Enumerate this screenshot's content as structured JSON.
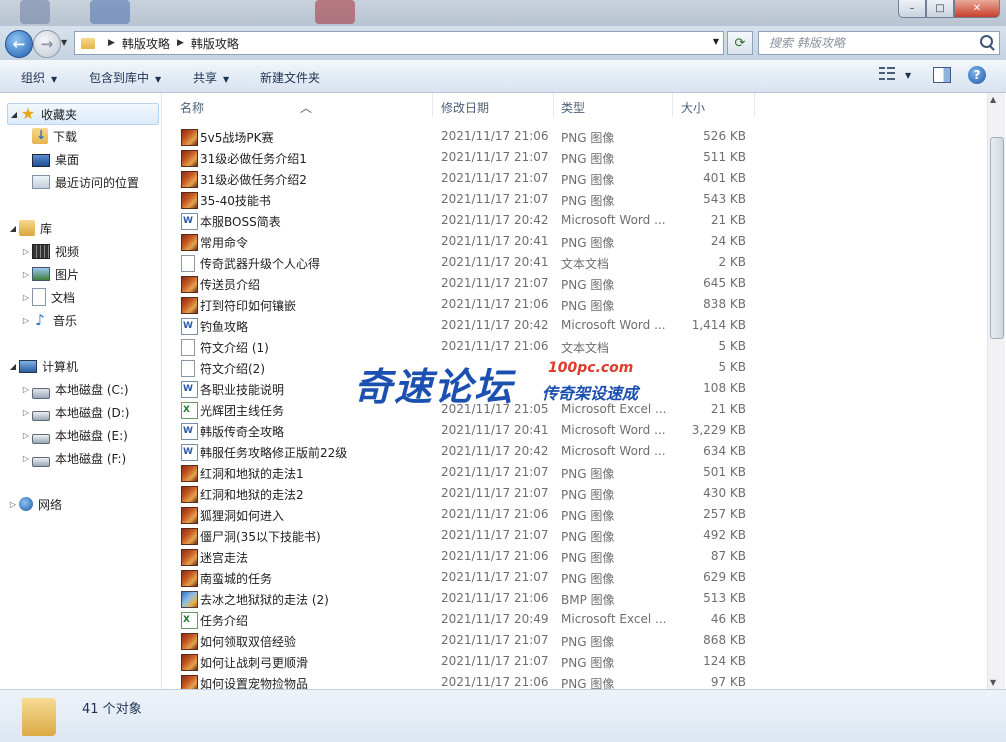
{
  "window": {
    "min_label": "–",
    "max_label": "□",
    "close_label": "✕"
  },
  "address": {
    "crumbs": [
      "韩版攻略",
      "韩版攻略"
    ],
    "search_placeholder": "搜索 韩版攻略"
  },
  "toolbar": {
    "organize": "组织",
    "include_library": "包含到库中",
    "share": "共享",
    "new_folder": "新建文件夹"
  },
  "nav": {
    "favorites": "收藏夹",
    "downloads": "下载",
    "desktop": "桌面",
    "recent": "最近访问的位置",
    "libraries": "库",
    "videos": "视频",
    "pictures": "图片",
    "documents": "文档",
    "music": "音乐",
    "computer": "计算机",
    "drive_c": "本地磁盘 (C:)",
    "drive_d": "本地磁盘 (D:)",
    "drive_e": "本地磁盘 (E:)",
    "drive_f": "本地磁盘 (F:)",
    "network": "网络"
  },
  "columns": {
    "name": "名称",
    "date": "修改日期",
    "type": "类型",
    "size": "大小"
  },
  "files": [
    {
      "icon": "png",
      "name": "5v5战场PK赛",
      "date": "2021/11/17 21:06",
      "type": "PNG 图像",
      "size": "526 KB"
    },
    {
      "icon": "png",
      "name": "31级必做任务介绍1",
      "date": "2021/11/17 21:07",
      "type": "PNG 图像",
      "size": "511 KB"
    },
    {
      "icon": "png",
      "name": "31级必做任务介绍2",
      "date": "2021/11/17 21:07",
      "type": "PNG 图像",
      "size": "401 KB"
    },
    {
      "icon": "png",
      "name": "35-40技能书",
      "date": "2021/11/17 21:07",
      "type": "PNG 图像",
      "size": "543 KB"
    },
    {
      "icon": "word",
      "name": "本服BOSS简表",
      "date": "2021/11/17 20:42",
      "type": "Microsoft Word ...",
      "size": "21 KB"
    },
    {
      "icon": "png",
      "name": "常用命令",
      "date": "2021/11/17 20:41",
      "type": "PNG 图像",
      "size": "24 KB"
    },
    {
      "icon": "txt",
      "name": "传奇武器升级个人心得",
      "date": "2021/11/17 20:41",
      "type": "文本文档",
      "size": "2 KB"
    },
    {
      "icon": "png",
      "name": "传送员介绍",
      "date": "2021/11/17 21:07",
      "type": "PNG 图像",
      "size": "645 KB"
    },
    {
      "icon": "png",
      "name": "打到符印如何镶嵌",
      "date": "2021/11/17 21:06",
      "type": "PNG 图像",
      "size": "838 KB"
    },
    {
      "icon": "word",
      "name": "钓鱼攻略",
      "date": "2021/11/17 20:42",
      "type": "Microsoft Word ...",
      "size": "1,414 KB"
    },
    {
      "icon": "txt",
      "name": "符文介绍 (1)",
      "date": "2021/11/17 21:06",
      "type": "文本文档",
      "size": "5 KB"
    },
    {
      "icon": "txt",
      "name": "符文介绍(2)",
      "date": "",
      "type": "",
      "size": "5 KB"
    },
    {
      "icon": "word",
      "name": "各职业技能说明",
      "date": "",
      "type": "",
      "size": "108 KB"
    },
    {
      "icon": "excel",
      "name": "光辉团主线任务",
      "date": "2021/11/17 21:05",
      "type": "Microsoft Excel ...",
      "size": "21 KB"
    },
    {
      "icon": "word",
      "name": "韩版传奇全攻略",
      "date": "2021/11/17 20:41",
      "type": "Microsoft Word ...",
      "size": "3,229 KB"
    },
    {
      "icon": "word",
      "name": "韩服任务攻略修正版前22级",
      "date": "2021/11/17 20:42",
      "type": "Microsoft Word ...",
      "size": "634 KB"
    },
    {
      "icon": "png",
      "name": "红洞和地狱的走法1",
      "date": "2021/11/17 21:07",
      "type": "PNG 图像",
      "size": "501 KB"
    },
    {
      "icon": "png",
      "name": "红洞和地狱的走法2",
      "date": "2021/11/17 21:07",
      "type": "PNG 图像",
      "size": "430 KB"
    },
    {
      "icon": "png",
      "name": "狐狸洞如何进入",
      "date": "2021/11/17 21:06",
      "type": "PNG 图像",
      "size": "257 KB"
    },
    {
      "icon": "png",
      "name": "僵尸洞(35以下技能书)",
      "date": "2021/11/17 21:07",
      "type": "PNG 图像",
      "size": "492 KB"
    },
    {
      "icon": "png",
      "name": "迷宫走法",
      "date": "2021/11/17 21:06",
      "type": "PNG 图像",
      "size": "87 KB"
    },
    {
      "icon": "png",
      "name": "南蛮城的任务",
      "date": "2021/11/17 21:07",
      "type": "PNG 图像",
      "size": "629 KB"
    },
    {
      "icon": "bmp",
      "name": "去冰之地狱狱的走法 (2)",
      "date": "2021/11/17 21:06",
      "type": "BMP 图像",
      "size": "513 KB"
    },
    {
      "icon": "excel",
      "name": "任务介绍",
      "date": "2021/11/17 20:49",
      "type": "Microsoft Excel ...",
      "size": "46 KB"
    },
    {
      "icon": "png",
      "name": "如何领取双倍经验",
      "date": "2021/11/17 21:07",
      "type": "PNG 图像",
      "size": "868 KB"
    },
    {
      "icon": "png",
      "name": "如何让战刺弓更顺滑",
      "date": "2021/11/17 21:07",
      "type": "PNG 图像",
      "size": "124 KB"
    },
    {
      "icon": "png",
      "name": "如何设置宠物捡物品",
      "date": "2021/11/17 21:06",
      "type": "PNG 图像",
      "size": "97 KB"
    }
  ],
  "watermark": {
    "main": "奇速论坛",
    "site": "100pc.com",
    "sub": "传奇架设速成"
  },
  "status": {
    "count": "41 个对象"
  }
}
